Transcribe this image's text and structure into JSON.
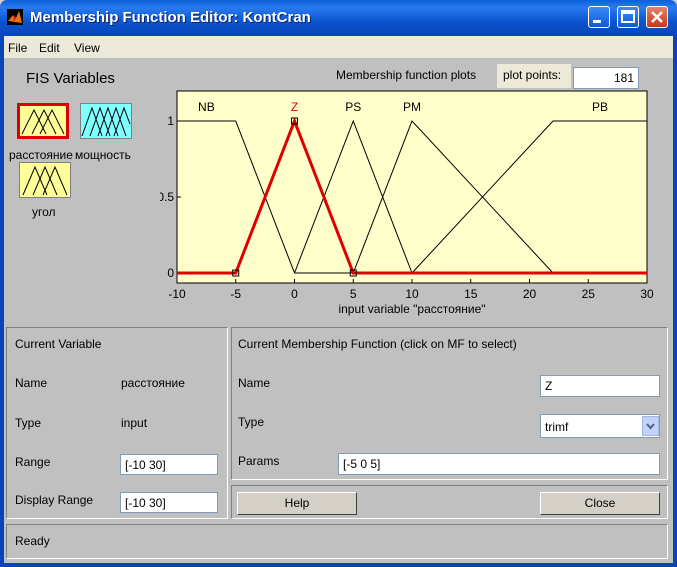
{
  "window": {
    "title": "Membership Function Editor: KontCran"
  },
  "menu": [
    "File",
    "Edit",
    "View"
  ],
  "fis": {
    "heading": "FIS Variables",
    "vars": [
      {
        "label": "расстояние",
        "color": "#ffff99",
        "selected": true
      },
      {
        "label": "мощность",
        "color": "#80ffff",
        "selected": false
      },
      {
        "label": "угол",
        "color": "#ffff99",
        "selected": false
      }
    ]
  },
  "plot": {
    "heading": "Membership function plots",
    "points_label": "plot points:",
    "points_value": "181",
    "xlabel": "input variable \"расстояние\"",
    "bg": "#ffffcc",
    "highlight_color": "#e00000"
  },
  "chart_data": {
    "type": "line",
    "xlim": [
      -10,
      30
    ],
    "ylim": [
      0,
      1
    ],
    "xticks": [
      -10,
      -5,
      0,
      5,
      10,
      15,
      20,
      25,
      30
    ],
    "yticks": [
      0,
      0.5,
      1
    ],
    "ytick_labels": [
      "0",
      "0.5",
      "1"
    ],
    "xlabel": "input variable \"расстояние\"",
    "series": [
      {
        "name": "NB",
        "type": "trapmf",
        "points": [
          [
            -10,
            1
          ],
          [
            -5,
            1
          ],
          [
            0,
            0
          ],
          [
            30,
            0
          ]
        ],
        "selected": false
      },
      {
        "name": "Z",
        "type": "trimf",
        "points": [
          [
            -10,
            0
          ],
          [
            -5,
            0
          ],
          [
            0,
            1
          ],
          [
            5,
            0
          ],
          [
            30,
            0
          ]
        ],
        "selected": true
      },
      {
        "name": "PS",
        "type": "trimf",
        "points": [
          [
            0,
            0
          ],
          [
            5,
            1
          ],
          [
            10,
            0
          ]
        ],
        "selected": false
      },
      {
        "name": "PM",
        "type": "trimf",
        "points": [
          [
            5,
            0
          ],
          [
            10,
            1
          ],
          [
            22,
            0
          ]
        ],
        "selected": false
      },
      {
        "name": "PB",
        "type": "trapmf",
        "points": [
          [
            10,
            0
          ],
          [
            22,
            1
          ],
          [
            30,
            1
          ]
        ],
        "selected": false
      }
    ],
    "labels": [
      {
        "text": "NB",
        "x": -7.5
      },
      {
        "text": "Z",
        "x": 0
      },
      {
        "text": "PS",
        "x": 5
      },
      {
        "text": "PM",
        "x": 10
      },
      {
        "text": "PB",
        "x": 26
      }
    ]
  },
  "current_variable": {
    "heading": "Current Variable",
    "name_label": "Name",
    "name_value": "расстояние",
    "type_label": "Type",
    "type_value": "input",
    "range_label": "Range",
    "range_value": "[-10 30]",
    "display_label": "Display Range",
    "display_value": "[-10 30]"
  },
  "current_mf": {
    "heading": "Current Membership Function (click on MF to select)",
    "name_label": "Name",
    "name_value": "Z",
    "type_label": "Type",
    "type_value": "trimf",
    "params_label": "Params",
    "params_value": "[-5 0 5]"
  },
  "buttons": {
    "help": "Help",
    "close": "Close"
  },
  "status": "Ready"
}
